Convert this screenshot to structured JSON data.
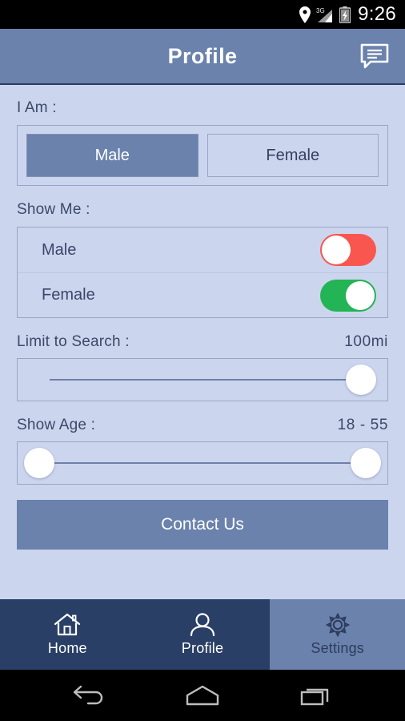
{
  "statusbar": {
    "location_icon": "location-pin-icon",
    "network_label": "3G",
    "signal_icon": "signal-bars-icon",
    "battery_icon": "battery-charging-icon",
    "time": "9:26"
  },
  "header": {
    "title": "Profile",
    "action_icon": "chat-bubble-icon"
  },
  "sections": {
    "i_am": {
      "label": "I Am :",
      "options": [
        {
          "label": "Male",
          "selected": true
        },
        {
          "label": "Female",
          "selected": false
        }
      ]
    },
    "show_me": {
      "label": "Show Me :",
      "rows": [
        {
          "label": "Male",
          "state": "off"
        },
        {
          "label": "Female",
          "state": "on"
        }
      ]
    },
    "limit_to_search": {
      "label": "Limit to Search :",
      "value": "100mi"
    },
    "show_age": {
      "label": "Show Age :",
      "value": "18  -  55",
      "min": "18",
      "max": "55"
    }
  },
  "contact": {
    "label": "Contact Us"
  },
  "tabbar": {
    "tabs": [
      {
        "label": "Home",
        "icon": "home-icon",
        "active": false
      },
      {
        "label": "Profile",
        "icon": "person-icon",
        "active": false
      },
      {
        "label": "Settings",
        "icon": "gear-icon",
        "active": true
      }
    ]
  },
  "navbar": {
    "back": "back-icon",
    "home": "home-nav-icon",
    "recents": "recents-icon"
  },
  "colors": {
    "header_blue": "#6a82ac",
    "page_background": "#ccd5ee",
    "tabbar_navy": "#2a3f66",
    "toggle_on_green": "#22b455",
    "toggle_off_red": "#f9564f",
    "text_navy": "#3b4a68"
  }
}
